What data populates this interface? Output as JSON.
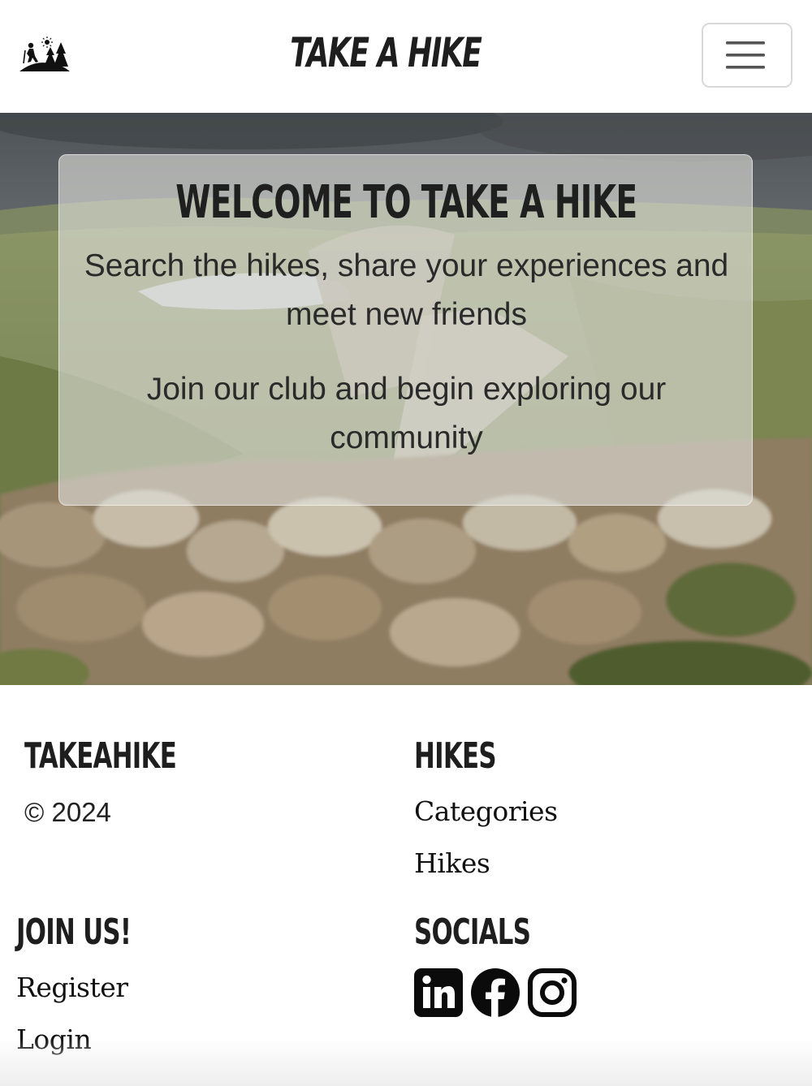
{
  "navbar": {
    "brand_title": "TAKE A HIKE",
    "logo_icon": "hiker-trees-logo-icon",
    "menu_icon": "hamburger-menu-icon"
  },
  "hero": {
    "title": "WELCOME TO TAKE A HIKE",
    "paragraph_1": "Search the hikes, share your experiences and meet new friends",
    "paragraph_2": "Join our club and begin exploring our community"
  },
  "footer": {
    "brand": {
      "heading": "TAKEAHIKE",
      "copyright": "© 2024"
    },
    "hikes": {
      "heading": "HIKES",
      "links": [
        "Categories",
        "Hikes"
      ]
    },
    "join": {
      "heading": "JOIN US!",
      "links": [
        "Register",
        "Login"
      ]
    },
    "socials": {
      "heading": "SOCIALS",
      "icons": [
        "linkedin-icon",
        "facebook-icon",
        "instagram-icon"
      ]
    }
  },
  "colors": {
    "text_dark": "#1e1e1e",
    "card_overlay": "#e1e1dc",
    "toggler_border": "#d9d9d9"
  }
}
